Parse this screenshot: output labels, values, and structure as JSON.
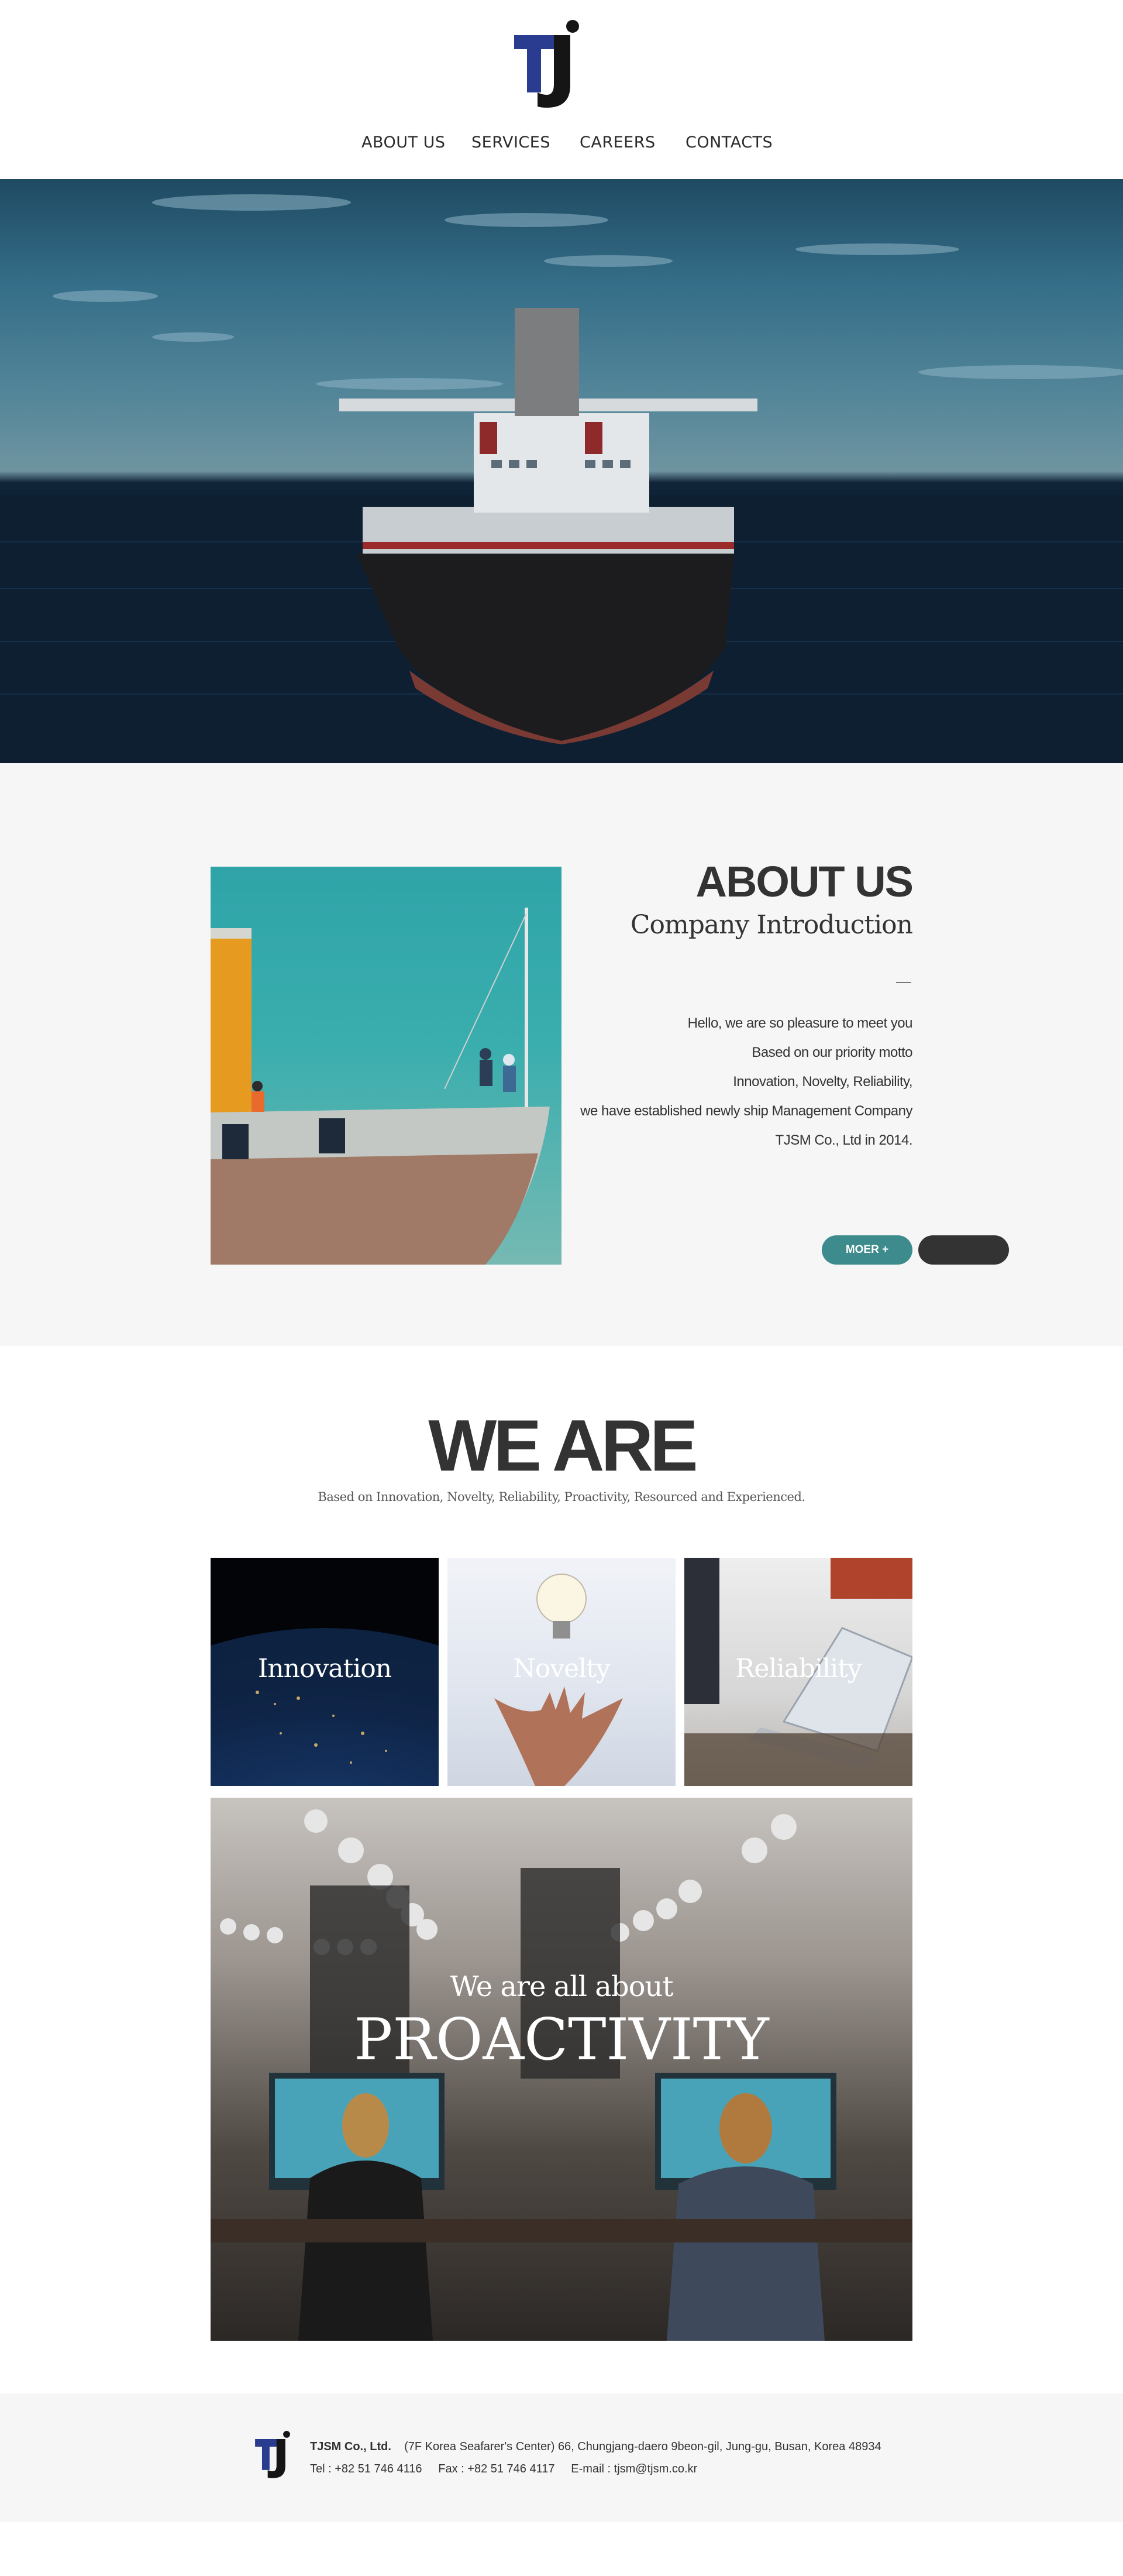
{
  "brand": {
    "logo_text": "TJ",
    "colors": {
      "logo_blue": "#2a3c8f",
      "logo_black": "#151515",
      "accent": "#3d8b8c",
      "dark_button": "#333333",
      "section_bg": "#f6f6f6"
    }
  },
  "nav": {
    "items": [
      {
        "label": "ABOUT US"
      },
      {
        "label": "SERVICES"
      },
      {
        "label": "CAREERS"
      },
      {
        "label": "CONTACTS"
      }
    ]
  },
  "about": {
    "title": "ABOUT US",
    "subtitle": "Company Introduction",
    "body": [
      "Hello, we are so pleasure to meet you",
      "Based on our priority motto",
      "Innovation, Novelty, Reliability,",
      "we have established newly  ship Management Company",
      "TJSM Co., Ltd in 2014."
    ],
    "more_button": "MOER +"
  },
  "weare": {
    "title": "WE ARE",
    "subtitle": "Based on Innovation, Novelty, Reliability, Proactivity, Resourced and Experienced.",
    "tiles": [
      {
        "label": "Innovation"
      },
      {
        "label": "Novelty"
      },
      {
        "label": "Reliability"
      }
    ],
    "feature": {
      "small": "We are all about",
      "large": "PROACTIVITY"
    }
  },
  "footer": {
    "company": "TJSM Co., Ltd.",
    "address": "(7F Korea Seafarer's Center) 66, Chungjang-daero 9beon-gil, Jung-gu, Busan, Korea 48934",
    "tel": "Tel : +82 51 746 4116",
    "fax": "Fax : +82 51 746 4117",
    "email": "E-mail : tjsm@tjsm.co.kr"
  }
}
